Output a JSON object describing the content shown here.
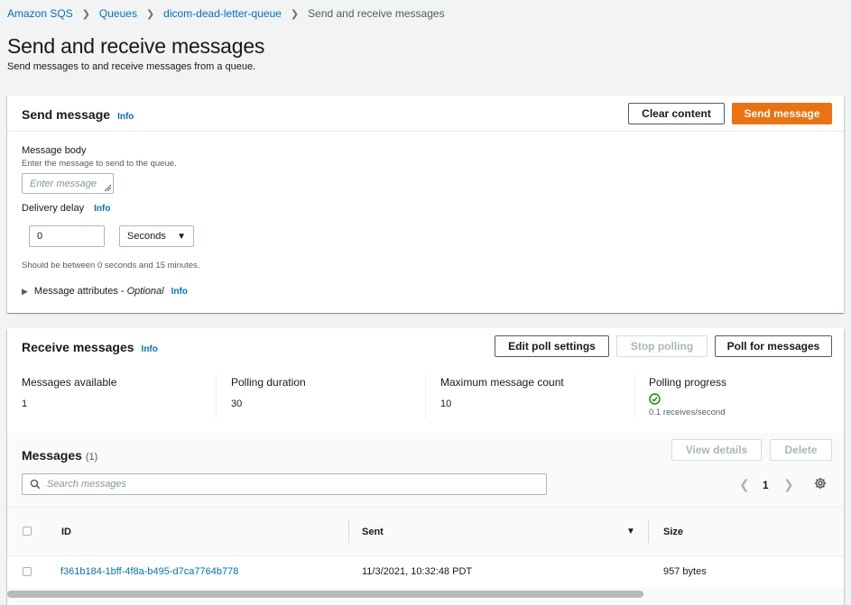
{
  "breadcrumb": {
    "items": [
      "Amazon SQS",
      "Queues",
      "dicom-dead-letter-queue"
    ],
    "current": "Send and receive messages"
  },
  "page": {
    "title": "Send and receive messages",
    "subtitle": "Send messages to and receive messages from a queue."
  },
  "send": {
    "title": "Send message",
    "info": "Info",
    "clear_label": "Clear content",
    "send_label": "Send message",
    "body_label": "Message body",
    "body_desc": "Enter the message to send to the queue.",
    "body_placeholder": "Enter message",
    "delay_label": "Delivery delay",
    "delay_info": "Info",
    "delay_value": "0",
    "delay_unit": "Seconds",
    "delay_hint": "Should be between 0 seconds and 15 minutes.",
    "attributes_label": "Message attributes - ",
    "attributes_optional": "Optional",
    "attributes_info": "Info"
  },
  "receive": {
    "title": "Receive messages",
    "info": "Info",
    "edit_label": "Edit poll settings",
    "stop_label": "Stop polling",
    "poll_label": "Poll for messages",
    "metrics": [
      {
        "label": "Messages available",
        "value": "1"
      },
      {
        "label": "Polling duration",
        "value": "30"
      },
      {
        "label": "Maximum message count",
        "value": "10"
      },
      {
        "label": "Polling progress",
        "value": "0.1 receives/second"
      }
    ]
  },
  "messages": {
    "title": "Messages",
    "count": "(1)",
    "view_label": "View details",
    "delete_label": "Delete",
    "search_placeholder": "Search messages",
    "page_number": "1",
    "columns": [
      "ID",
      "Sent",
      "Size"
    ],
    "rows": [
      {
        "id": "f361b184-1bff-4f8a-b495-d7ca7764b778",
        "sent": "11/3/2021, 10:32:48 PDT",
        "size": "957 bytes"
      }
    ]
  },
  "colors": {
    "primary": "#ec7211",
    "link": "#0073bb",
    "success": "#1d8102"
  }
}
